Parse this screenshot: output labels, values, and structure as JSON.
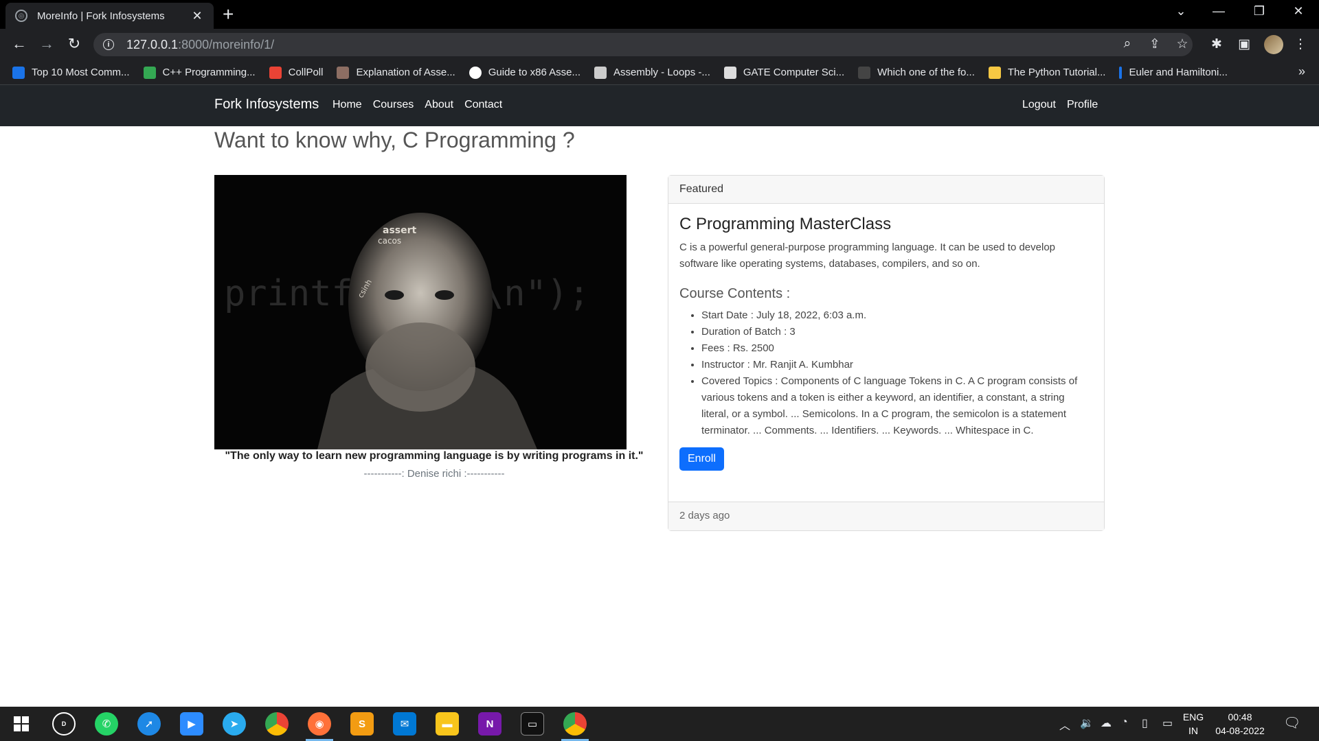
{
  "browser": {
    "tab_title": "MoreInfo | Fork Infosystems",
    "url_host": "127.0.0.1",
    "url_path": ":8000/moreinfo/1/",
    "bookmarks": [
      {
        "label": "Top 10 Most Comm...",
        "color": "#1a73e8"
      },
      {
        "label": "C++ Programming...",
        "color": "#34a853"
      },
      {
        "label": "CollPoll",
        "color": "#ea4335"
      },
      {
        "label": "Explanation of Asse...",
        "color": "#8d6e63"
      },
      {
        "label": "Guide to x86 Asse...",
        "color": "#ffffff"
      },
      {
        "label": "Assembly - Loops -...",
        "color": "#cccccc"
      },
      {
        "label": "GATE Computer Sci...",
        "color": "#dddddd"
      },
      {
        "label": "Which one of the fo...",
        "color": "#444444"
      },
      {
        "label": "The Python Tutorial...",
        "color": "#f7c843"
      },
      {
        "label": "Euler and Hamiltoni...",
        "color": "#1a73e8"
      }
    ],
    "more_bookmarks": "»"
  },
  "site": {
    "brand": "Fork Infosystems",
    "nav": [
      "Home",
      "Courses",
      "About",
      "Contact"
    ],
    "nav_right": [
      "Logout",
      "Profile"
    ]
  },
  "page": {
    "heading": "Want to know why, C Programming ?",
    "hero_text_left": "printf (\"",
    "hero_text_right": "\\n\");",
    "hero_words": [
      "assert",
      "cacos",
      "csinh"
    ],
    "quote": "\"The only way to learn new programming language is by writing programs in it.\"",
    "quote_author": "-----------: Denise richi :-----------"
  },
  "card": {
    "header": "Featured",
    "title": "C Programming MasterClass",
    "description": "C is a powerful general-purpose programming language. It can be used to develop software like operating systems, databases, compilers, and so on.",
    "contents_heading": "Course Contents :",
    "items": [
      "Start Date : July 18, 2022, 6:03 a.m.",
      "Duration of Batch : 3",
      "Fees : Rs. 2500",
      "Instructor : Mr. Ranjit A. Kumbhar",
      "Covered Topics : Components of C language Tokens in C. A C program consists of various tokens and a token is either a keyword, an identifier, a constant, a string literal, or a symbol. ... Semicolons. In a C program, the semicolon is a statement terminator. ... Comments. ... Identifiers. ... Keywords. ... Whitespace in C."
    ],
    "button": "Enroll",
    "footer": "2 days ago"
  },
  "taskbar": {
    "lang_top": "ENG",
    "lang_bottom": "IN",
    "time": "00:48",
    "date": "04-08-2022"
  }
}
